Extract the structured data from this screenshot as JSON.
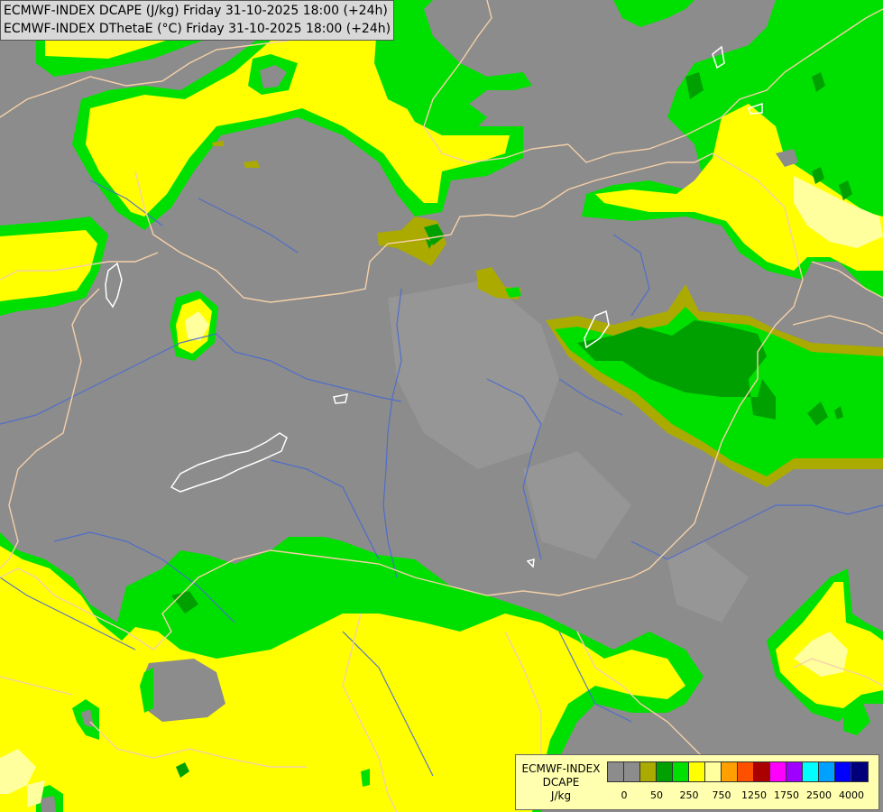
{
  "header": {
    "line1": "ECMWF-INDEX DCAPE (J/kg) Friday 31-10-2025 18:00 (+24h)",
    "line2": "ECMWF-INDEX DThetaE (°C) Friday 31-10-2025 18:00 (+24h)"
  },
  "legend": {
    "line1": "ECMWF-INDEX",
    "line2": "DCAPE",
    "line3": "J/kg",
    "colors": [
      "#8c8c8c",
      "#8c8c8c",
      "#aaaa00",
      "#00a000",
      "#00e000",
      "#ffff00",
      "#ffff9e",
      "#ffa000",
      "#ff5000",
      "#aa0000",
      "#ff00ff",
      "#a000ff",
      "#00ffff",
      "#00a0ff",
      "#0000ff",
      "#00007a"
    ],
    "ticks": [
      "0",
      "50",
      "250",
      "750",
      "1250",
      "1750",
      "2500",
      "4000"
    ]
  },
  "map_layers": {
    "field_colors": {
      "none": "#8c8c8c",
      "olive": "#aaaa00",
      "dark_green": "#00a000",
      "green": "#00e000",
      "yellow": "#ffff00",
      "pale_yellow": "#ffff9e"
    },
    "border_color": "#f5d0a8",
    "river_color": "#4466cc",
    "lake_color": "#ffffff"
  }
}
